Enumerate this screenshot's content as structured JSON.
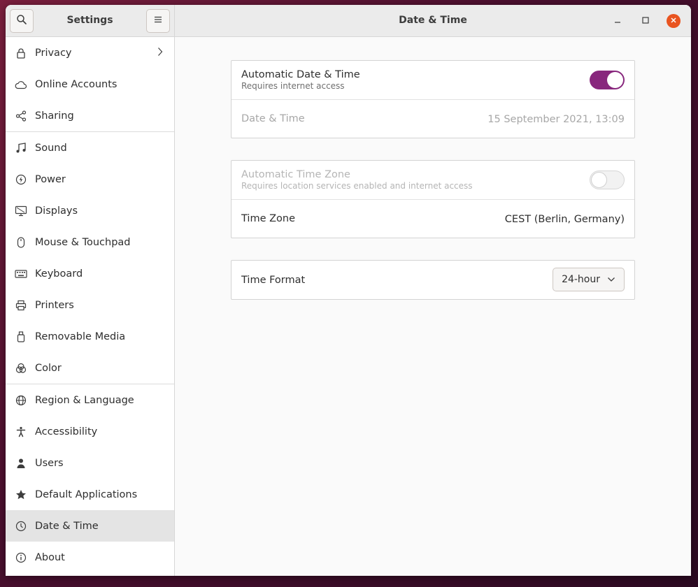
{
  "sidebar_header": {
    "title": "Settings"
  },
  "main_header": {
    "title": "Date & Time"
  },
  "sidebar": {
    "items": [
      {
        "label": "Privacy",
        "icon": "lock-icon",
        "has_chevron": true
      },
      {
        "label": "Online Accounts",
        "icon": "cloud-icon"
      },
      {
        "label": "Sharing",
        "icon": "share-icon"
      },
      {
        "label": "Sound",
        "icon": "music-note-icon"
      },
      {
        "label": "Power",
        "icon": "power-icon"
      },
      {
        "label": "Displays",
        "icon": "display-icon"
      },
      {
        "label": "Mouse & Touchpad",
        "icon": "mouse-icon"
      },
      {
        "label": "Keyboard",
        "icon": "keyboard-icon"
      },
      {
        "label": "Printers",
        "icon": "printer-icon"
      },
      {
        "label": "Removable Media",
        "icon": "usb-drive-icon"
      },
      {
        "label": "Color",
        "icon": "color-icon"
      },
      {
        "label": "Region & Language",
        "icon": "globe-icon"
      },
      {
        "label": "Accessibility",
        "icon": "accessibility-icon"
      },
      {
        "label": "Users",
        "icon": "user-icon"
      },
      {
        "label": "Default Applications",
        "icon": "star-icon"
      },
      {
        "label": "Date & Time",
        "icon": "clock-icon",
        "active": true
      },
      {
        "label": "About",
        "icon": "info-icon"
      }
    ]
  },
  "date_time_frame": {
    "auto_date_time": {
      "label": "Automatic Date & Time",
      "sublabel": "Requires internet access",
      "enabled": true
    },
    "date_time": {
      "label": "Date & Time",
      "value": "15 September 2021, 13:09"
    }
  },
  "timezone_frame": {
    "auto_timezone": {
      "label": "Automatic Time Zone",
      "sublabel": "Requires location services enabled and internet access",
      "enabled": false
    },
    "timezone": {
      "label": "Time Zone",
      "value": "CEST (Berlin, Germany)"
    }
  },
  "time_format_frame": {
    "time_format": {
      "label": "Time Format",
      "value": "24-hour"
    }
  },
  "colors": {
    "accent": "#88277d",
    "close_button": "#e95420"
  }
}
